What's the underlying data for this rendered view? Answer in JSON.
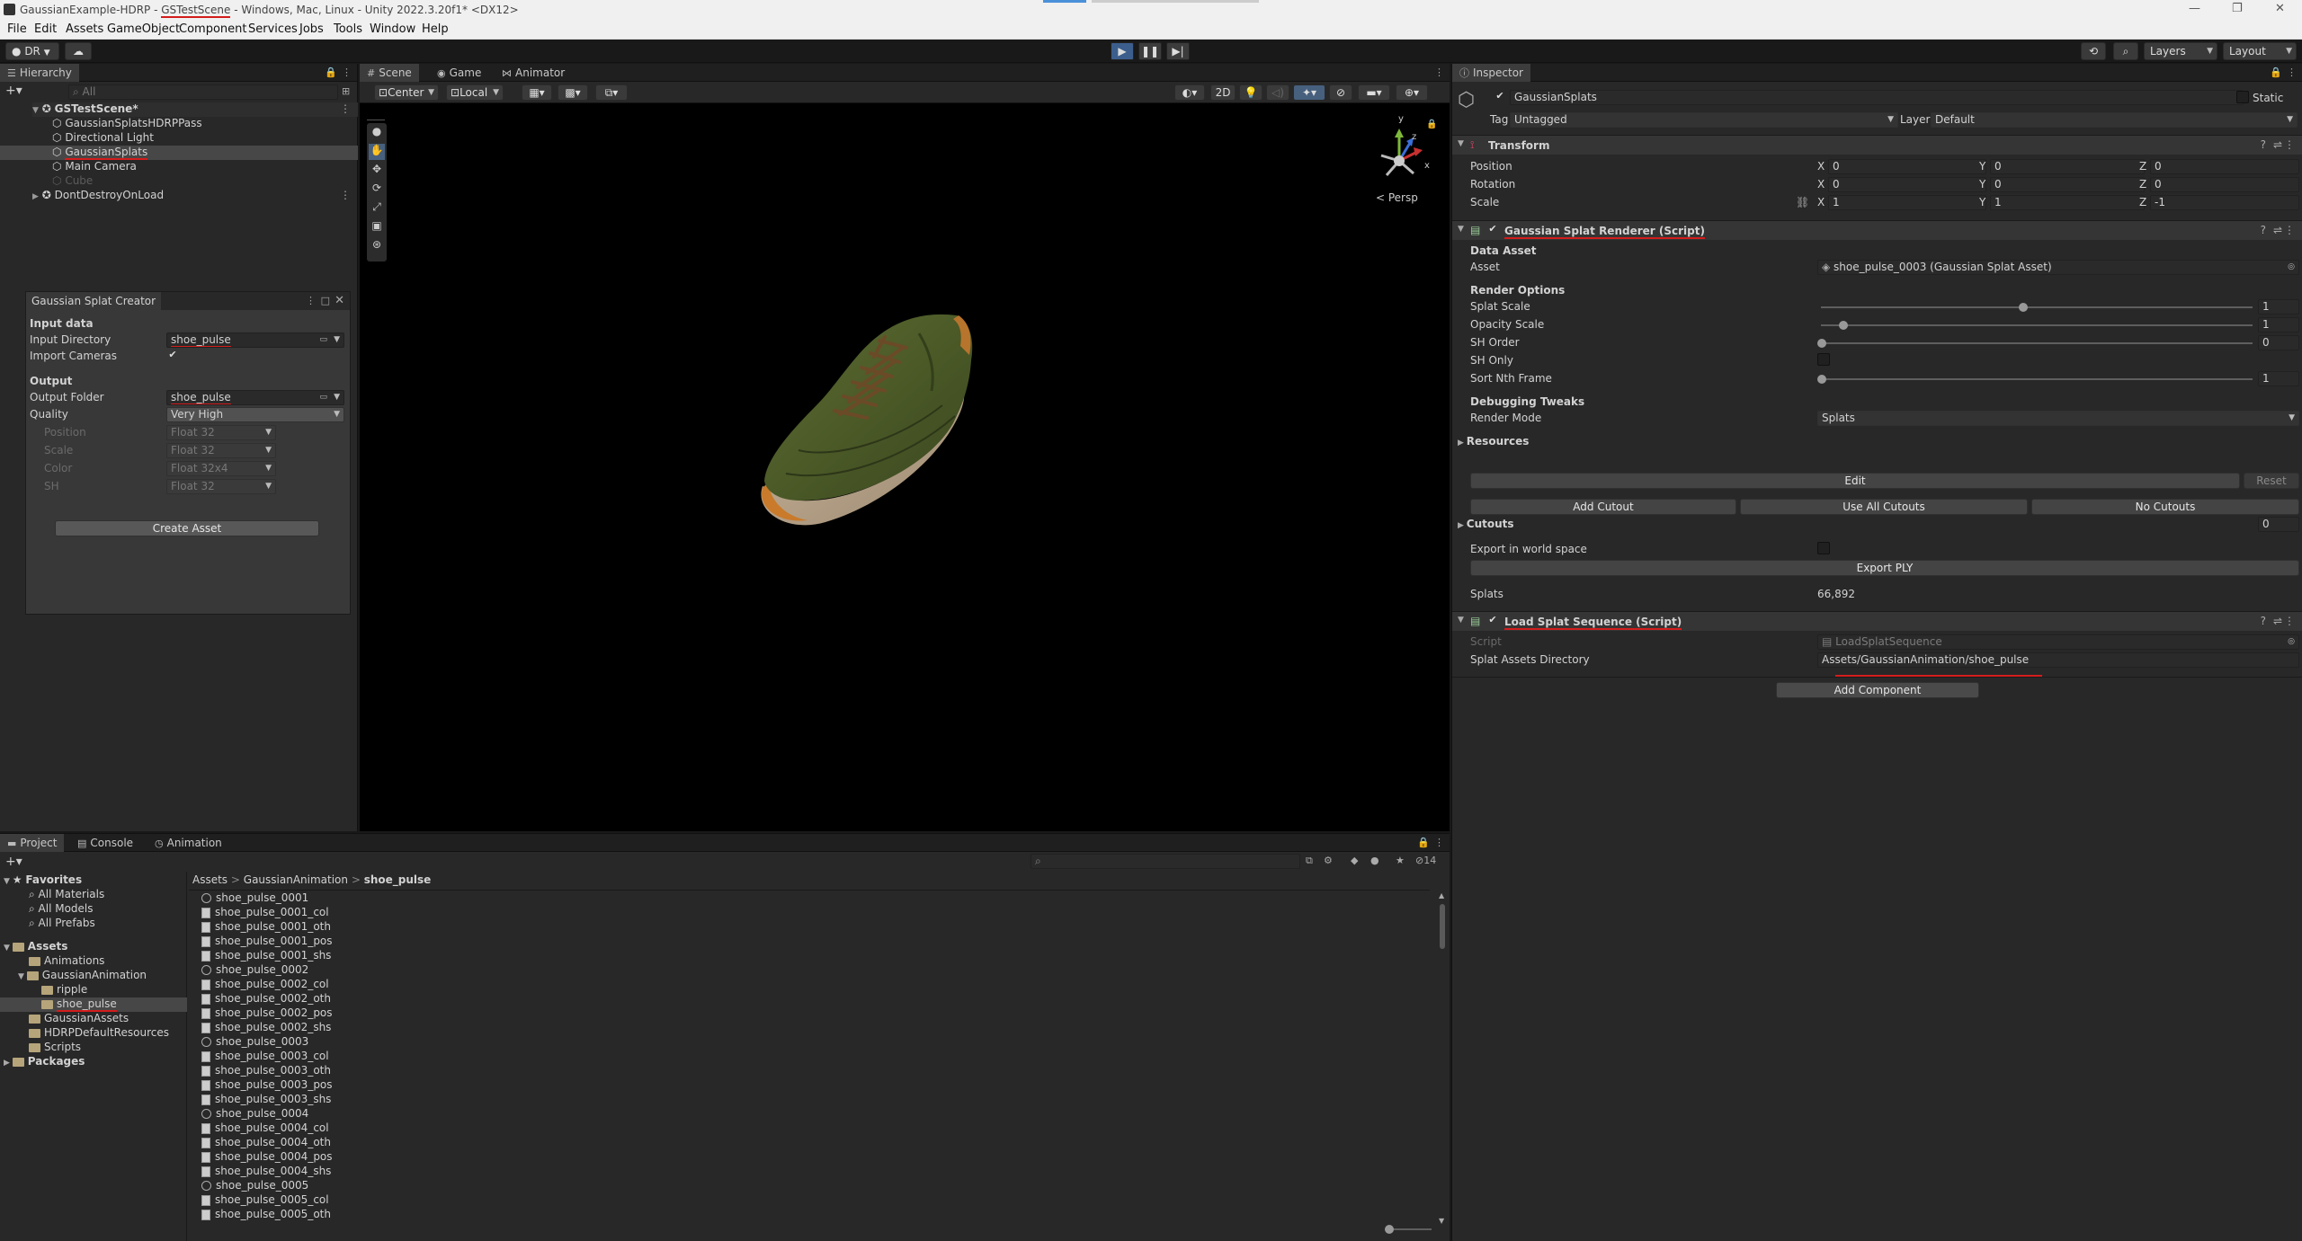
{
  "titlebar": {
    "prefix": "GaussianExample-HDRP - ",
    "scene": "GSTestScene",
    "suffix": " - Windows, Mac, Linux - Unity 2022.3.20f1* <DX12>",
    "minimize": "—",
    "maximize": "❐",
    "close": "✕"
  },
  "menu": [
    "File",
    "Edit",
    "Assets",
    "GameObject",
    "Component",
    "Services",
    "Jobs",
    "Tools",
    "Window",
    "Help"
  ],
  "toolbar": {
    "account": "DR",
    "layers": "Layers",
    "layout": "Layout"
  },
  "hierarchy": {
    "tab": "Hierarchy",
    "search_placeholder": "All",
    "scene": "GSTestScene*",
    "items": [
      "GaussianSplatsHDRPPass",
      "Directional Light",
      "GaussianSplats",
      "Main Camera",
      "Cube"
    ],
    "ddol": "DontDestroyOnLoad"
  },
  "creator": {
    "title": "Gaussian Splat Creator",
    "input_data": "Input data",
    "input_dir_label": "Input Directory",
    "input_dir_value": "shoe_pulse",
    "import_cameras": "Import Cameras",
    "output": "Output",
    "output_folder_label": "Output Folder",
    "output_folder_value": "shoe_pulse",
    "quality_label": "Quality",
    "quality_value": "Very High",
    "position_label": "Position",
    "position_value": "Float 32",
    "scale_label": "Scale",
    "scale_value": "Float 32",
    "color_label": "Color",
    "color_value": "Float 32x4",
    "sh_label": "SH",
    "sh_value": "Float 32",
    "create_button": "Create Asset"
  },
  "scene_view": {
    "tabs": [
      "Scene",
      "Game",
      "Animator"
    ],
    "pivot": "Center",
    "space": "Local",
    "mode_2d": "2D",
    "persp": "< Persp",
    "axis_y": "y",
    "axis_x": "x",
    "axis_z": "z"
  },
  "inspector": {
    "tab": "Inspector",
    "object_name": "GaussianSplats",
    "static_label": "Static",
    "tag_label": "Tag",
    "tag_value": "Untagged",
    "layer_label": "Layer",
    "layer_value": "Default",
    "transform": {
      "title": "Transform",
      "position": "Position",
      "rotation": "Rotation",
      "scale": "Scale",
      "x": "X",
      "y": "Y",
      "z": "Z",
      "pos": [
        "0",
        "0",
        "0"
      ],
      "rot": [
        "0",
        "0",
        "0"
      ],
      "scl": [
        "1",
        "1",
        "-1"
      ]
    },
    "renderer": {
      "title": "Gaussian Splat Renderer (Script)",
      "data_asset": "Data Asset",
      "asset_label": "Asset",
      "asset_value": "shoe_pulse_0003 (Gaussian Splat Asset)",
      "render_options": "Render Options",
      "splat_scale": "Splat Scale",
      "splat_scale_value": "1",
      "opacity_scale": "Opacity Scale",
      "opacity_scale_value": "1",
      "sh_order": "SH Order",
      "sh_order_value": "0",
      "sh_only": "SH Only",
      "sort_nth": "Sort Nth Frame",
      "sort_nth_value": "1",
      "debugging": "Debugging Tweaks",
      "render_mode": "Render Mode",
      "render_mode_value": "Splats",
      "resources": "Resources",
      "edit": "Edit",
      "reset": "Reset",
      "add_cutout": "Add Cutout",
      "use_all_cutouts": "Use All Cutouts",
      "no_cutouts": "No Cutouts",
      "cutouts": "Cutouts",
      "cutouts_count": "0",
      "export_world": "Export in world space",
      "export_ply": "Export PLY",
      "splats_label": "Splats",
      "splats_value": "66,892"
    },
    "loader": {
      "title": "Load Splat Sequence (Script)",
      "script_label": "Script",
      "script_value": "LoadSplatSequence",
      "dir_label": "Splat Assets Directory",
      "dir_value": "Assets/GaussianAnimation/shoe_pulse"
    },
    "add_component": "Add Component"
  },
  "project": {
    "tabs": [
      "Project",
      "Console",
      "Animation"
    ],
    "favorites": "Favorites",
    "fav_items": [
      "All Materials",
      "All Models",
      "All Prefabs"
    ],
    "assets": "Assets",
    "tree": [
      "Animations",
      "GaussianAnimation",
      "ripple",
      "shoe_pulse",
      "GaussianAssets",
      "HDRPDefaultResources",
      "Scripts"
    ],
    "packages": "Packages",
    "breadcrumb": [
      "Assets",
      "GaussianAnimation",
      "shoe_pulse"
    ],
    "hidden_count": "14",
    "files": [
      "shoe_pulse_0001",
      "shoe_pulse_0001_col",
      "shoe_pulse_0001_oth",
      "shoe_pulse_0001_pos",
      "shoe_pulse_0001_shs",
      "shoe_pulse_0002",
      "shoe_pulse_0002_col",
      "shoe_pulse_0002_oth",
      "shoe_pulse_0002_pos",
      "shoe_pulse_0002_shs",
      "shoe_pulse_0003",
      "shoe_pulse_0003_col",
      "shoe_pulse_0003_oth",
      "shoe_pulse_0003_pos",
      "shoe_pulse_0003_shs",
      "shoe_pulse_0004",
      "shoe_pulse_0004_col",
      "shoe_pulse_0004_oth",
      "shoe_pulse_0004_pos",
      "shoe_pulse_0004_shs",
      "shoe_pulse_0005",
      "shoe_pulse_0005_col",
      "shoe_pulse_0005_oth"
    ]
  },
  "colors": {
    "accent_red": "#d41c1c",
    "panel": "#282828",
    "selected": "#2c5d87"
  }
}
